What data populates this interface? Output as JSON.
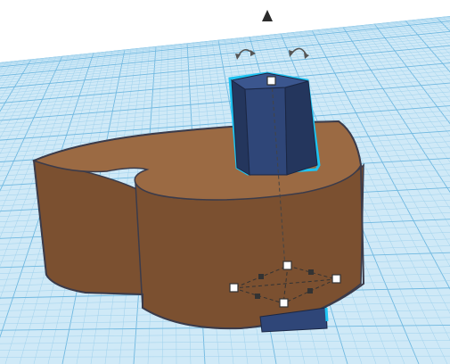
{
  "scene": {
    "colors": {
      "background": "#ffffff",
      "workplane": "#cfe9f7",
      "grid_minor": "#9fd1ec",
      "grid_major": "#6fb8e0",
      "heart_top": "#9b6a43",
      "heart_side": "#7b5030",
      "heart_side_dark": "#5c3a22",
      "heart_outline": "#3b3b4a",
      "prism_front": "#2f4678",
      "prism_side": "#24365d",
      "prism_top": "#3b568e",
      "selection_outline": "#1ec3f2",
      "handle_fill": "#ffffff",
      "handle_stroke": "#333333",
      "scale_handle": "#333333",
      "arrow": "#2b2b2b",
      "rotate_arrow": "#555555"
    },
    "selected_object": {
      "type": "hexagonal-prism"
    },
    "gizmo": {
      "icons": [
        "lift-arrow-icon",
        "rotate-left-icon",
        "rotate-right-icon",
        "top-center-handle-icon",
        "corner-handle-icon",
        "edge-scale-handle-icon"
      ]
    },
    "objects": [
      "heart",
      "hexagonal-prism"
    ]
  }
}
